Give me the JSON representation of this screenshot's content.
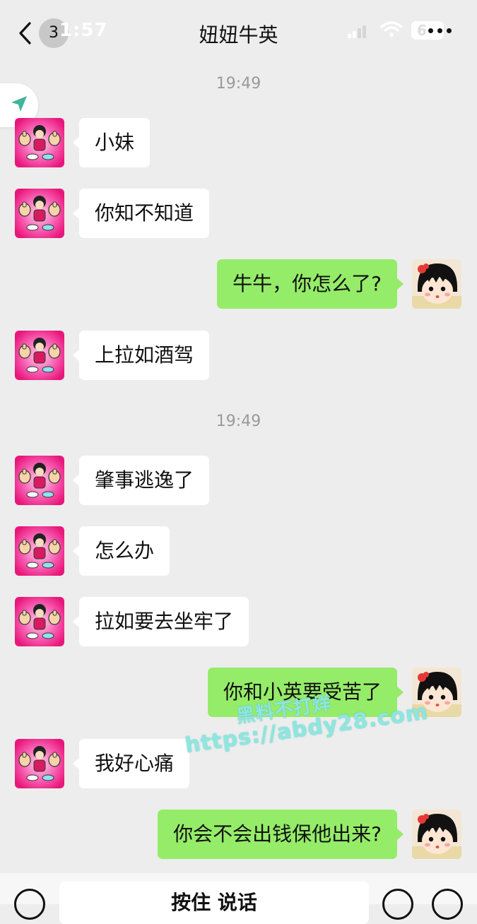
{
  "status_bar": {
    "time": "1:57",
    "battery": "6"
  },
  "nav": {
    "title": "妞妞牛英",
    "unread_count": "3"
  },
  "timestamps": [
    "19:49",
    "19:49"
  ],
  "messages": [
    {
      "text": "小妹"
    },
    {
      "text": "你知不知道"
    },
    {
      "text": "牛牛，你怎么了?"
    },
    {
      "text": "上拉如酒驾"
    },
    {
      "text": "肇事逃逸了"
    },
    {
      "text": "怎么办"
    },
    {
      "text": "拉如要去坐牢了"
    },
    {
      "text": "你和小英要受苦了"
    },
    {
      "text": "我好心痛"
    },
    {
      "text": "你会不会出钱保他出来?"
    }
  ],
  "watermark": {
    "line1": "黑料不打烊",
    "line2": "https://abdy28.com"
  },
  "input_bar": {
    "voice_label": "按住 说话"
  },
  "colors": {
    "background": "#ededed",
    "outgoing_bubble": "#95ec69",
    "incoming_bubble": "#ffffff",
    "avatar_left_bg": "#e8177a"
  }
}
